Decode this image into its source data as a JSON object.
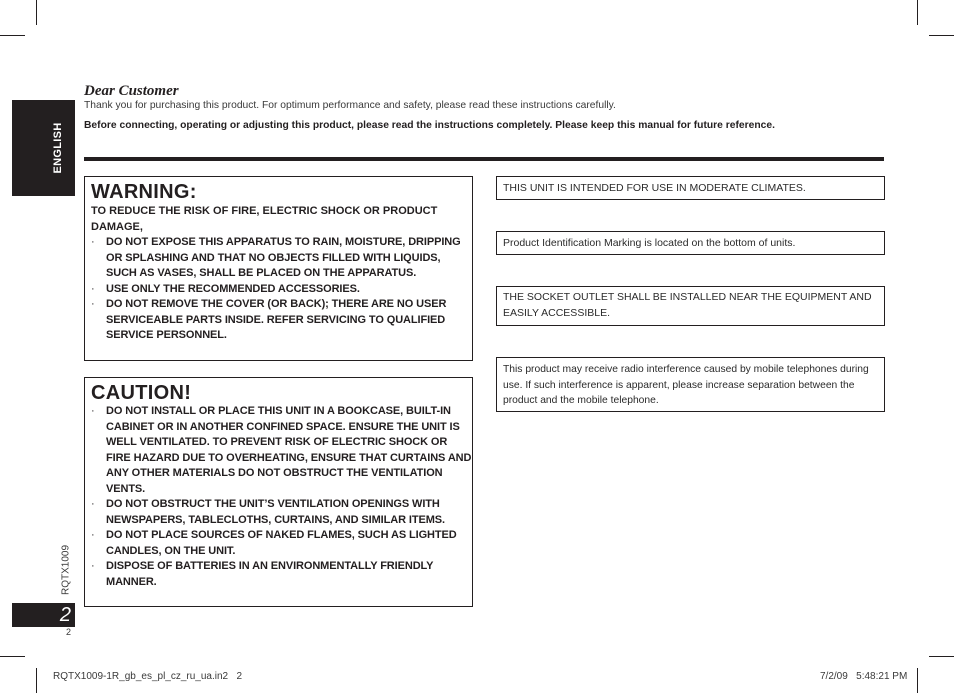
{
  "side_tab": {
    "language": "ENGLISH"
  },
  "header": {
    "title": "Dear Customer",
    "intro": "Thank you for purchasing this product. For optimum performance and safety, please read these instructions carefully.",
    "intro_bold": "Before connecting, operating or adjusting this product, please read the instructions completely. Please keep this manual for future reference."
  },
  "warning": {
    "heading": "WARNING:",
    "lead": "TO REDUCE THE RISK OF FIRE, ELECTRIC SHOCK OR PRODUCT DAMAGE,",
    "bullet": "·",
    "items": [
      "DO NOT EXPOSE THIS APPARATUS TO RAIN, MOISTURE, DRIPPING OR SPLASHING AND THAT NO OBJECTS FILLED WITH LIQUIDS, SUCH AS VASES, SHALL BE PLACED ON THE APPARATUS.",
      "USE ONLY THE RECOMMENDED ACCESSORIES.",
      "DO NOT REMOVE THE COVER (OR BACK); THERE ARE NO USER SERVICEABLE PARTS INSIDE. REFER SERVICING TO QUALIFIED SERVICE PERSONNEL."
    ]
  },
  "caution": {
    "heading": "CAUTION!",
    "bullet": "·",
    "items": [
      "DO NOT INSTALL OR PLACE THIS UNIT IN A BOOKCASE, BUILT-IN CABINET OR IN ANOTHER CONFINED SPACE. ENSURE THE UNIT IS WELL VENTILATED. TO PREVENT RISK OF ELECTRIC SHOCK OR FIRE HAZARD DUE TO OVERHEATING, ENSURE THAT CURTAINS AND ANY OTHER MATERIALS DO NOT OBSTRUCT THE VENTILATION VENTS.",
      "DO NOT OBSTRUCT THE UNIT’S VENTILATION OPENINGS WITH NEWSPAPERS, TABLECLOTHS, CURTAINS, AND SIMILAR ITEMS.",
      "DO NOT PLACE SOURCES OF NAKED FLAMES, SUCH AS LIGHTED CANDLES, ON THE UNIT.",
      "DISPOSE OF BATTERIES IN AN ENVIRONMENTALLY FRIENDLY MANNER."
    ]
  },
  "notes": [
    "THIS UNIT IS INTENDED FOR USE IN MODERATE CLIMATES.",
    "Product Identification Marking is located on the bottom of units.",
    "THE SOCKET OUTLET SHALL BE INSTALLED NEAR THE EQUIPMENT AND EASILY ACCESSIBLE.",
    "This product may receive radio interference caused by mobile telephones during use. If such interference is apparent, please increase separation between the product and the mobile telephone."
  ],
  "page": {
    "doc_code": "RQTX1009",
    "number": "2",
    "number_small": "2"
  },
  "footer": {
    "file": "RQTX1009-1R_gb_es_pl_cz_ru_ua.in2   2",
    "timestamp": "7/2/09   5:48:21 PM"
  }
}
